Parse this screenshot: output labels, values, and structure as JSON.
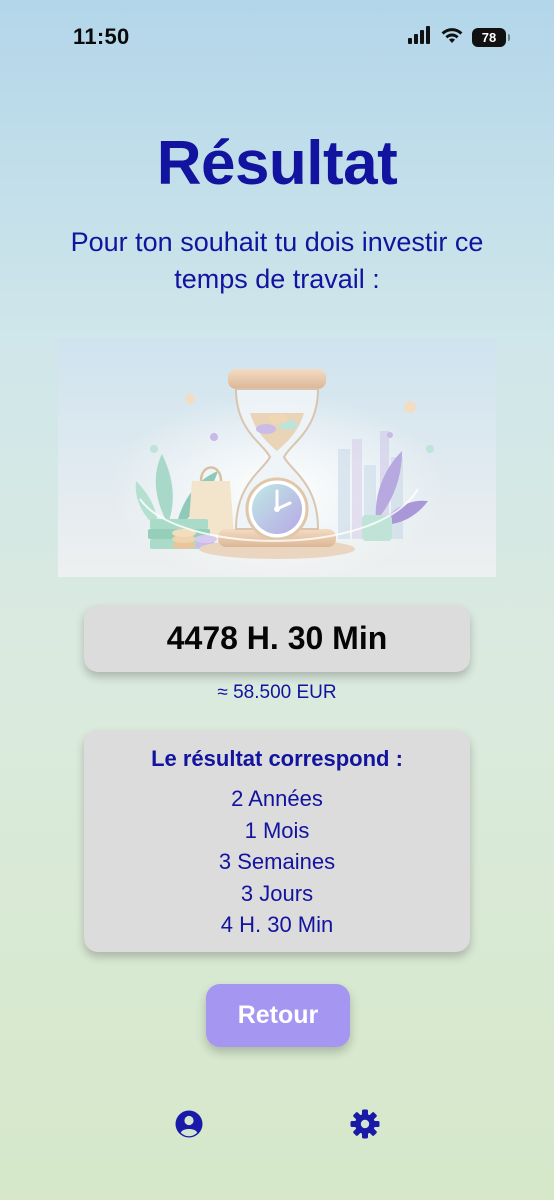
{
  "status_bar": {
    "time": "11:50",
    "battery": "78",
    "icons": [
      "signal-icon",
      "wifi-icon",
      "battery-icon"
    ]
  },
  "page": {
    "title": "Résultat",
    "subtitle": "Pour ton souhait tu dois investir ce temps de travail :"
  },
  "illustration": {
    "icon": "hourglass-clock-illustration"
  },
  "result": {
    "time": "4478 H. 30 Min",
    "amount": "≈ 58.500 EUR"
  },
  "breakdown": {
    "heading": "Le résultat correspond :",
    "items": [
      "2 Années",
      "1 Mois",
      "3 Semaines",
      "3 Jours",
      "4 H. 30 Min"
    ]
  },
  "actions": {
    "back_label": "Retour"
  },
  "nav": {
    "items": [
      "profile-icon",
      "settings-icon"
    ]
  },
  "colors": {
    "title": "#12139e",
    "button": "#a596f2",
    "card": "#dcdcdc",
    "nav_icon": "#1a1aa8"
  }
}
